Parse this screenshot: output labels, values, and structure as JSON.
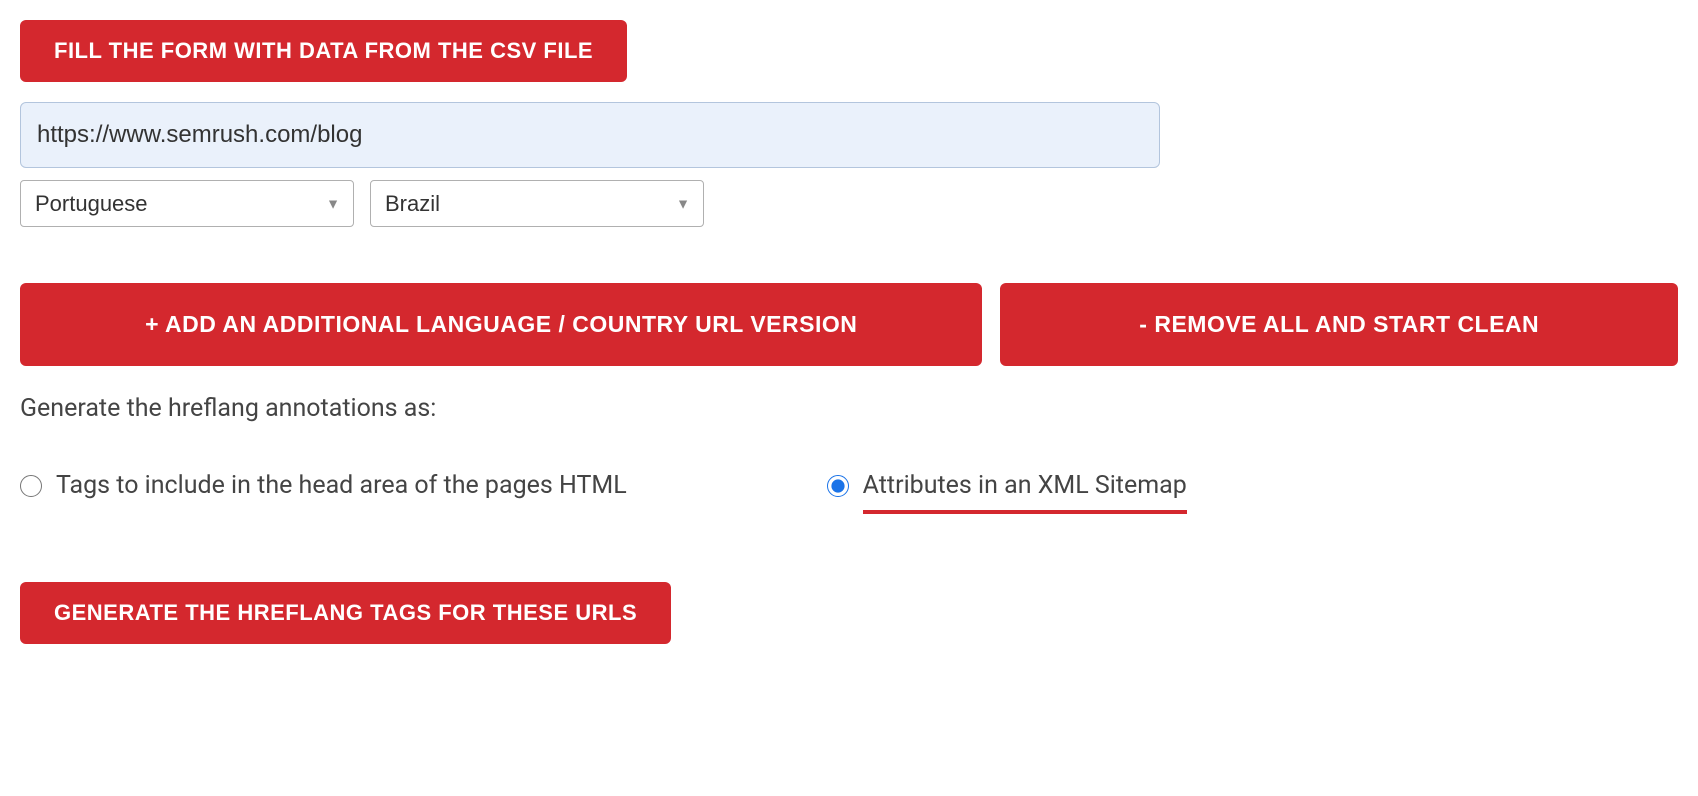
{
  "buttons": {
    "fill_csv": "FILL THE FORM WITH DATA FROM THE CSV FILE",
    "add_version": "+ ADD AN ADDITIONAL LANGUAGE / COUNTRY URL VERSION",
    "remove_all": "- REMOVE ALL AND START CLEAN",
    "generate": "GENERATE THE HREFLANG TAGS FOR THESE URLS"
  },
  "url_input": {
    "value": "https://www.semrush.com/blog"
  },
  "selects": {
    "language": "Portuguese",
    "country": "Brazil"
  },
  "labels": {
    "generate_as": "Generate the hreflang annotations as:"
  },
  "radios": {
    "head_tags": "Tags to include in the head area of the pages HTML",
    "xml_sitemap": "Attributes in an XML Sitemap"
  }
}
